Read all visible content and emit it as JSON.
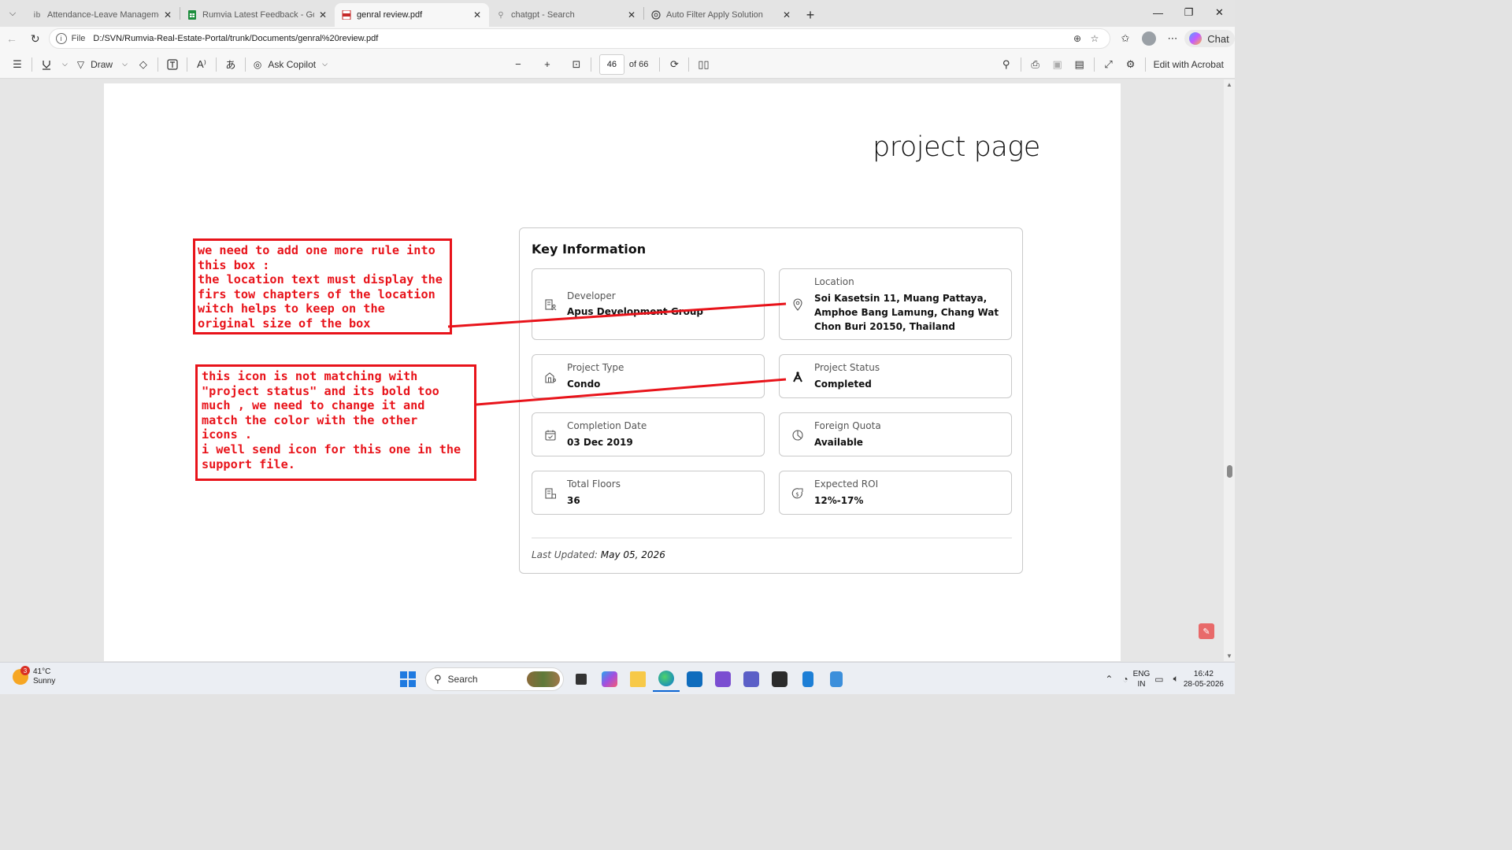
{
  "tabs": [
    {
      "label": "Attendance-Leave Management S",
      "icon": "ib-icon",
      "active": false
    },
    {
      "label": "Rumvia Latest Feedback - Google",
      "icon": "sheets-icon",
      "active": false
    },
    {
      "label": "genral review.pdf",
      "icon": "pdf-icon",
      "active": true
    },
    {
      "label": "chatgpt - Search",
      "icon": "search-icon",
      "active": false
    },
    {
      "label": "Auto Filter Apply Solution",
      "icon": "openai-icon",
      "active": false
    }
  ],
  "address": {
    "scheme": "File",
    "url": "D:/SVN/Rumvia-Real-Estate-Portal/trunk/Documents/genral%20review.pdf",
    "chat_label": "Chat"
  },
  "pdf_toolbar": {
    "draw_label": "Draw",
    "ask_copilot_label": "Ask Copilot",
    "page_current": "46",
    "page_total": "of 66",
    "edit_label": "Edit with Acrobat"
  },
  "page": {
    "title": "project page",
    "key_info": {
      "heading": "Key Information",
      "items": [
        {
          "label": "Developer",
          "value": "Apus Development Group",
          "icon": "building-user-icon"
        },
        {
          "label": "Location",
          "value": "Soi Kasetsin 11, Muang Pattaya, Amphoe Bang Lamung, Chang Wat Chon Buri 20150, Thailand",
          "icon": "map-pin-icon"
        },
        {
          "label": "Project Type",
          "value": "Condo",
          "icon": "home-building-icon"
        },
        {
          "label": "Project Status",
          "value": "Completed",
          "icon": "compass-tool-icon"
        },
        {
          "label": "Completion Date",
          "value": "03 Dec 2019",
          "icon": "calendar-check-icon"
        },
        {
          "label": "Foreign Quota",
          "value": "Available",
          "icon": "pie-chart-icon"
        },
        {
          "label": "Total Floors",
          "value": "36",
          "icon": "floors-icon"
        },
        {
          "label": "Expected ROI",
          "value": "12%-17%",
          "icon": "dollar-growth-icon"
        }
      ],
      "last_updated_label": "Last Updated:",
      "last_updated_value": "May 05, 2026"
    },
    "note1": "we need to add one more rule into\nthis box :\nthe location text must display the\nfirs tow chapters of the location\nwitch helps to keep on the\noriginal size of the box",
    "note2": "this icon is not matching with\n\"project status\" and its bold too\nmuch , we need to change it and\nmatch the color with the other\nicons .\ni well send icon for this one in the\nsupport file.",
    "annotation_color": "#e8131a"
  },
  "taskbar": {
    "weather_temp": "41°C",
    "weather_desc": "Sunny",
    "weather_badge": "3",
    "search_label": "Search",
    "lang_top": "ENG",
    "lang_bottom": "IN",
    "time": "16:42",
    "date": "28-05-2026"
  }
}
